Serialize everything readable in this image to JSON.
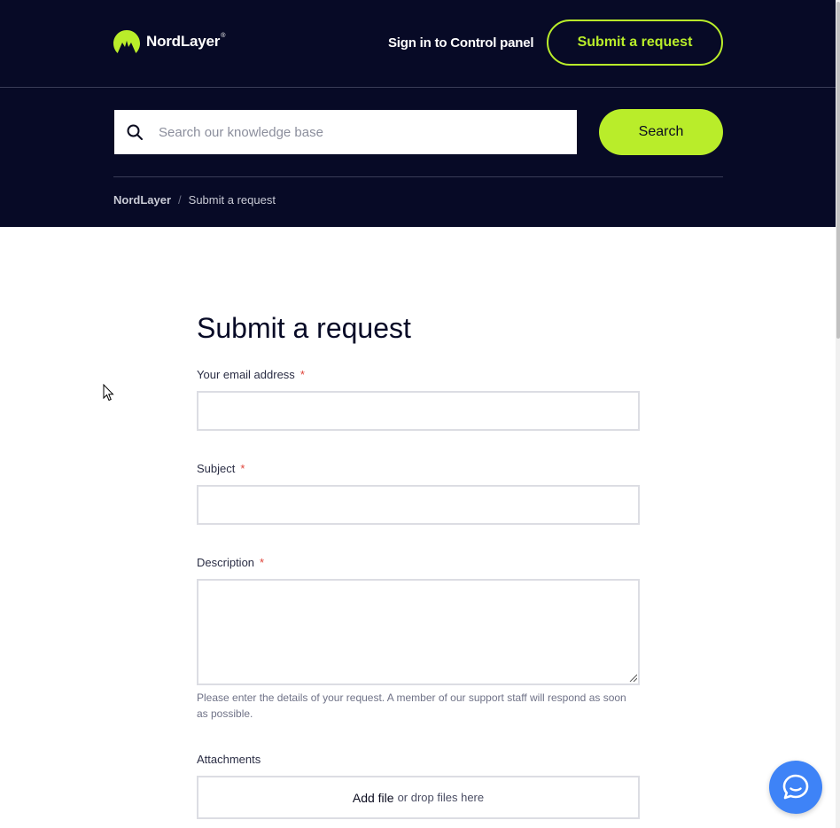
{
  "header": {
    "logo_text": "NordLayer",
    "logo_mark": "®",
    "signin_label": "Sign in to Control panel",
    "submit_label": "Submit a request"
  },
  "search": {
    "placeholder": "Search our knowledge base",
    "button_label": "Search"
  },
  "breadcrumb": {
    "home": "NordLayer",
    "separator": "/",
    "current": "Submit a request"
  },
  "form": {
    "title": "Submit a request",
    "required_marker": "*",
    "email_label": "Your email address",
    "subject_label": "Subject",
    "description_label": "Description",
    "description_hint": "Please enter the details of your request. A member of our support staff will respond as soon as possible.",
    "attachments_label": "Attachments",
    "add_file": "Add file",
    "drop_text": "or drop files here"
  },
  "icons": {
    "logo": "nordlayer-mountain-logo",
    "search": "search-icon",
    "chat": "chat-bubble-icon"
  },
  "colors": {
    "header_bg": "#070a26",
    "accent": "#b9ed2a",
    "chat": "#3e83f7",
    "required": "#e0443a"
  }
}
